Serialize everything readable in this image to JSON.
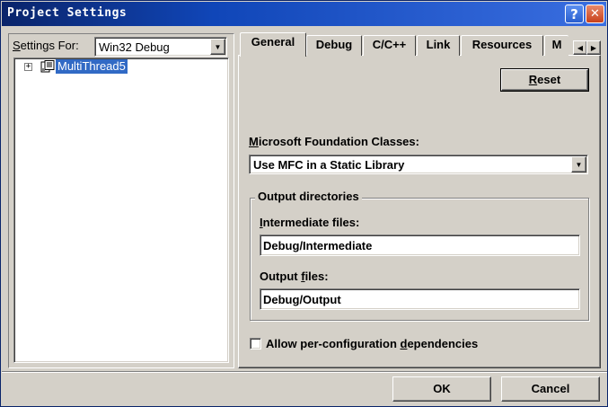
{
  "window": {
    "title": "Project Settings",
    "help_glyph": "?",
    "close_glyph": "✕"
  },
  "left": {
    "settings_for_prefix": "S",
    "settings_for_rest": "ettings For:",
    "settings_for_value": "Win32 Debug",
    "tree_expander": "+",
    "tree_item": "MultiThread5"
  },
  "tabs": [
    {
      "label": "General",
      "active": true
    },
    {
      "label": "Debug",
      "active": false
    },
    {
      "label": "C/C++",
      "active": false
    },
    {
      "label": "Link",
      "active": false
    },
    {
      "label": "Resources",
      "active": false
    },
    {
      "label": "M",
      "active": false
    }
  ],
  "general": {
    "reset_prefix": "R",
    "reset_rest": "eset",
    "mfc_label_prefix": "M",
    "mfc_label_rest": "icrosoft Foundation Classes:",
    "mfc_value": "Use MFC in a Static Library",
    "output_group_title": "Output directories",
    "intermediate_label_prefix": "I",
    "intermediate_label_rest": "ntermediate files:",
    "intermediate_value": "Debug/Intermediate",
    "output_label_pre": "Output ",
    "output_label_u": "f",
    "output_label_post": "iles:",
    "output_value": "Debug/Output",
    "checkbox_label_pre": "Allow per-configuration ",
    "checkbox_label_u": "d",
    "checkbox_label_post": "ependencies",
    "checkbox_checked": false
  },
  "footer": {
    "ok_label": "OK",
    "cancel_label": "Cancel"
  },
  "colors": {
    "titlebar_start": "#0a246a",
    "titlebar_end": "#3a6ee0",
    "selection": "#316ac5",
    "face": "#d4d0c8"
  },
  "icons": {
    "help": "help-icon",
    "close": "close-icon",
    "dropdown": "chevron-down-icon",
    "project": "project-icon",
    "scroll_left": "arrow-left-icon",
    "scroll_right": "arrow-right-icon"
  }
}
